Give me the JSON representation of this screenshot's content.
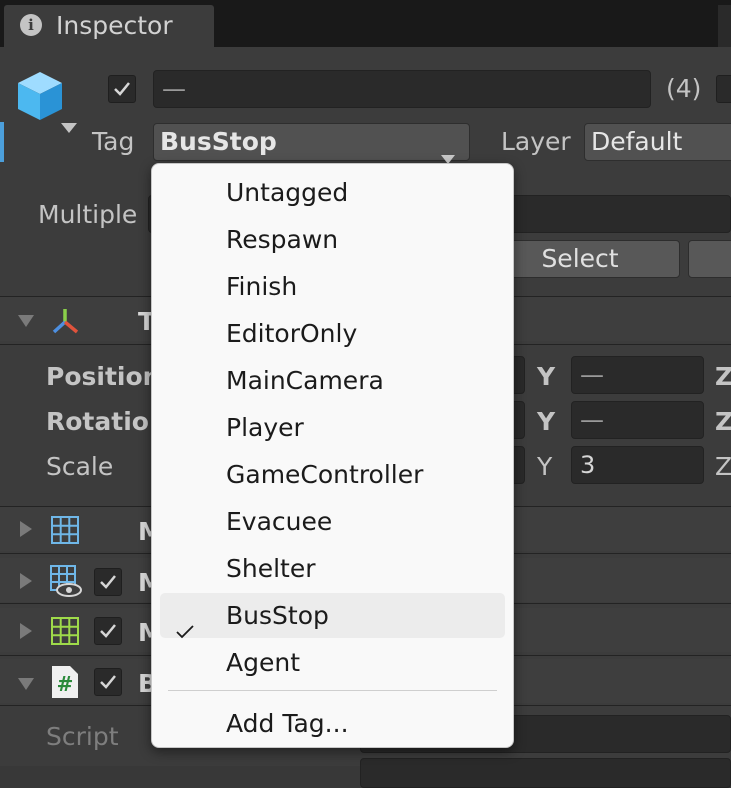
{
  "window": {
    "tab_title": "Inspector"
  },
  "header": {
    "name_value": "—",
    "count": "(4)",
    "tag_label": "Tag",
    "tag_value": "BusStop",
    "layer_label": "Layer",
    "layer_value": "Default",
    "multiple_label": "Multiple",
    "select_button": "Select"
  },
  "transform": {
    "rows": [
      {
        "label": "Position",
        "y_label": "Y",
        "y_value": "—",
        "z_label": "Z"
      },
      {
        "label": "Rotation",
        "y_label": "Y",
        "y_value": "—",
        "z_label": "Z"
      },
      {
        "label": "Scale",
        "y_label": "Y",
        "y_value": "3",
        "z_label": "Z"
      }
    ]
  },
  "components": {
    "script_label": "Script"
  },
  "tag_menu": {
    "items": [
      {
        "label": "Untagged",
        "checked": false
      },
      {
        "label": "Respawn",
        "checked": false
      },
      {
        "label": "Finish",
        "checked": false
      },
      {
        "label": "EditorOnly",
        "checked": false
      },
      {
        "label": "MainCamera",
        "checked": false
      },
      {
        "label": "Player",
        "checked": false
      },
      {
        "label": "GameController",
        "checked": false
      },
      {
        "label": "Evacuee",
        "checked": false
      },
      {
        "label": "Shelter",
        "checked": false
      },
      {
        "label": "BusStop",
        "checked": true
      },
      {
        "label": "Agent",
        "checked": false
      }
    ],
    "add_tag": "Add Tag..."
  },
  "colors": {
    "accent": "#4c9fdb",
    "panel": "#3c3c3c",
    "menu_bg": "#f9f9f9"
  }
}
